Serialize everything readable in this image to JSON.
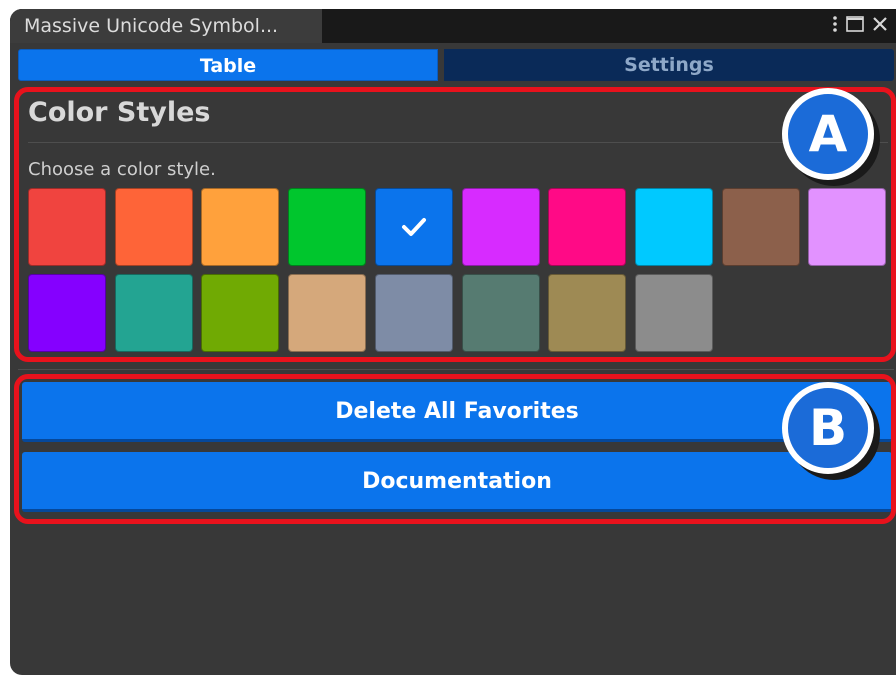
{
  "window": {
    "title": "Massive Unicode Symbol..."
  },
  "tabs": [
    {
      "label": "Table",
      "active": true
    },
    {
      "label": "Settings",
      "active": false
    }
  ],
  "color_styles": {
    "title": "Color Styles",
    "description": "Choose a color style.",
    "selected_index": 4,
    "swatches": [
      "#f0443f",
      "#fe6438",
      "#ffa13c",
      "#00c62d",
      "#0b74ec",
      "#d72bff",
      "#ff0a86",
      "#00c9ff",
      "#8c604b",
      "#e292ff",
      "#8500ff",
      "#23a492",
      "#70aa03",
      "#d5a87b",
      "#7e8ca6",
      "#567b71",
      "#9e8a54",
      "#8c8c8c"
    ]
  },
  "actions": {
    "delete_favorites": "Delete All Favorites",
    "documentation": "Documentation"
  },
  "annotations": {
    "marker_a": "A",
    "marker_b": "B"
  },
  "colors": {
    "accent": "#0b74ec",
    "highlight": "#e8121c",
    "background": "#383838"
  },
  "icons": {
    "selected": "checkmark-icon",
    "menu": "kebab-menu-icon",
    "maximize": "maximize-icon",
    "close": "close-icon"
  }
}
